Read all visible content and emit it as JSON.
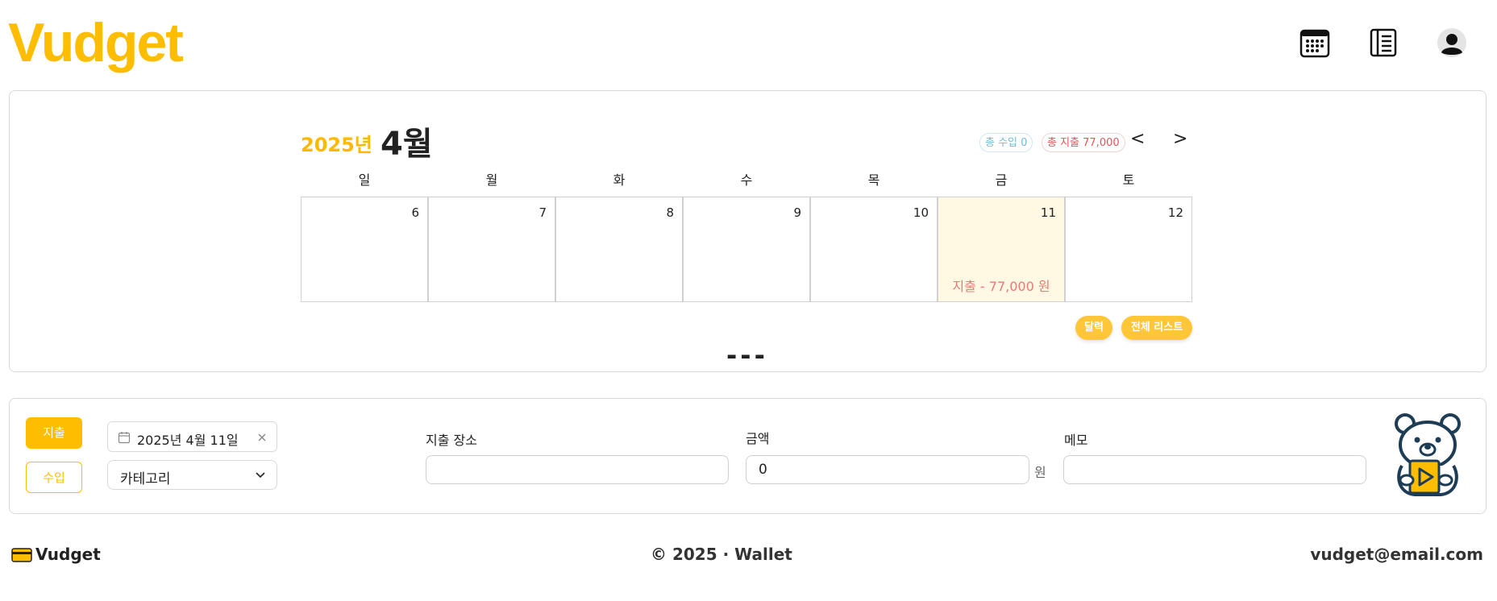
{
  "header": {
    "logo": "Vudget",
    "icons": [
      "calendar-grid-icon",
      "list-icon",
      "user-avatar-icon"
    ]
  },
  "calendar": {
    "year_label": "2025년",
    "month_label": "4월",
    "total_income_label": "총 수입 0",
    "total_expense_label": "총 지출 77,000",
    "prev_label": "<",
    "next_label": ">",
    "weekdays": [
      "일",
      "월",
      "화",
      "수",
      "목",
      "금",
      "토"
    ],
    "days": [
      {
        "num": "6",
        "expense": ""
      },
      {
        "num": "7",
        "expense": ""
      },
      {
        "num": "8",
        "expense": ""
      },
      {
        "num": "9",
        "expense": ""
      },
      {
        "num": "10",
        "expense": ""
      },
      {
        "num": "11",
        "expense": "지출 - 77,000 원",
        "selected": true
      },
      {
        "num": "12",
        "expense": ""
      }
    ],
    "view_calendar_label": "달력",
    "view_list_label": "전체 리스트",
    "collapse_label": "---"
  },
  "form": {
    "expense_type_label": "지출",
    "income_type_label": "수입",
    "date_value": "2025년 4월 11일",
    "category_placeholder": "카테고리",
    "place_label": "지출 장소",
    "place_value": "",
    "amount_label": "금액",
    "amount_value": "0",
    "amount_unit": "원",
    "memo_label": "메모",
    "memo_value": ""
  },
  "footer": {
    "brand": "Vudget",
    "copyright": "© 2025 · Wallet",
    "email": "vudget@email.com"
  },
  "colors": {
    "brand": "#ffbd00",
    "selected_day_bg": "#fff8e3",
    "expense_text": "#e87a7a",
    "income_text": "#6ebcdc"
  }
}
